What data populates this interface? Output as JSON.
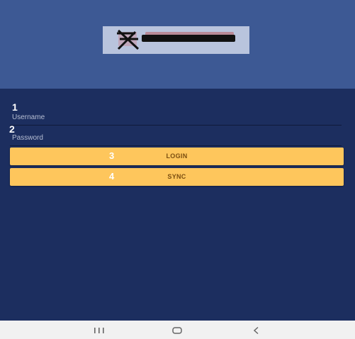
{
  "header": {
    "logo": {
      "icon": "company-logo"
    }
  },
  "login_form": {
    "steps": {
      "username": "1",
      "password": "2",
      "login": "3",
      "sync": "4"
    },
    "username_placeholder": "Username",
    "password_placeholder": "Password",
    "login_label": "LOGIN",
    "sync_label": "SYNC"
  },
  "navbar": {
    "recent_icon": "recent-apps-icon",
    "home_icon": "home-icon",
    "back_icon": "back-icon"
  },
  "colors": {
    "header_bg": "#3d5994",
    "main_bg": "#1c2e5f",
    "button_bg": "#fec65c",
    "button_text": "#7a4d10",
    "navbar_bg": "#f1f1f1"
  }
}
